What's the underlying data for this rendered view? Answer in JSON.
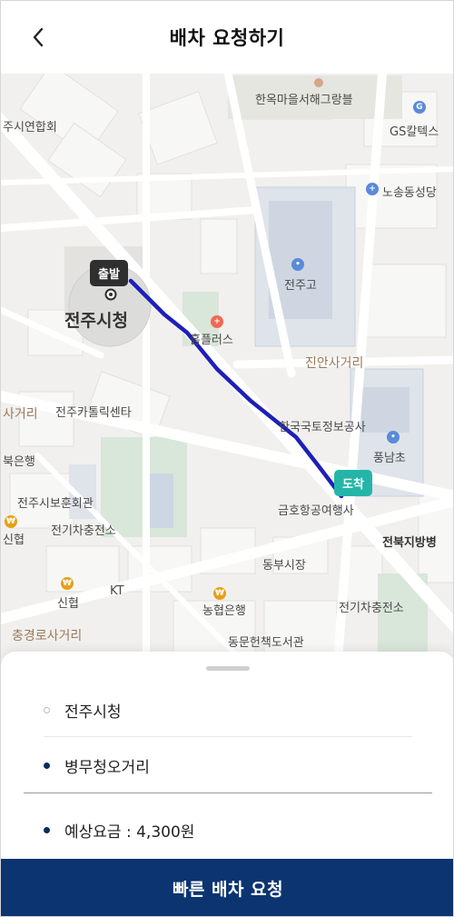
{
  "header": {
    "title": "배차 요청하기",
    "back_icon": "chevron-left-icon"
  },
  "map": {
    "labels": {
      "hanok": "한옥마을서해그랑블",
      "gs": "GS칼텍스",
      "hall_assoc": "주시연합회",
      "nosong": "노송동성당",
      "jeonju_high": "전주고",
      "city_hall": "전주시청",
      "homeplus": "홈플러스",
      "jinan": "진안사거리",
      "catholic": "전주카톨릭센타",
      "road_left": "사거리",
      "kookmin": "북은행",
      "info_agency": "한국국토정보공사",
      "pungnam": "풍남초",
      "seokho": "금호항공여행사",
      "boryeok": "전주시보훈회관",
      "charger1": "전기차충전소",
      "jeonbuk": "전북지방병",
      "shinhyup_left": "신협",
      "dongbu": "동부시장",
      "shinhyup": "신협",
      "kt": "KT",
      "nonghyup": "농협은행",
      "charger2": "전기차충전소",
      "chunggyeong": "충경로사거리",
      "library": "동문헌책도서관"
    },
    "markers": {
      "start": "출발",
      "end": "도착"
    },
    "route_color": "#1d1fb8"
  },
  "sheet": {
    "origin": "전주시청",
    "destination": "병무청오거리",
    "fare": "예상요금 : 4,300원"
  },
  "cta": {
    "label": "빠른 배차 요청"
  },
  "colors": {
    "brand": "#0c3470",
    "accent_end": "#23b6a8"
  }
}
